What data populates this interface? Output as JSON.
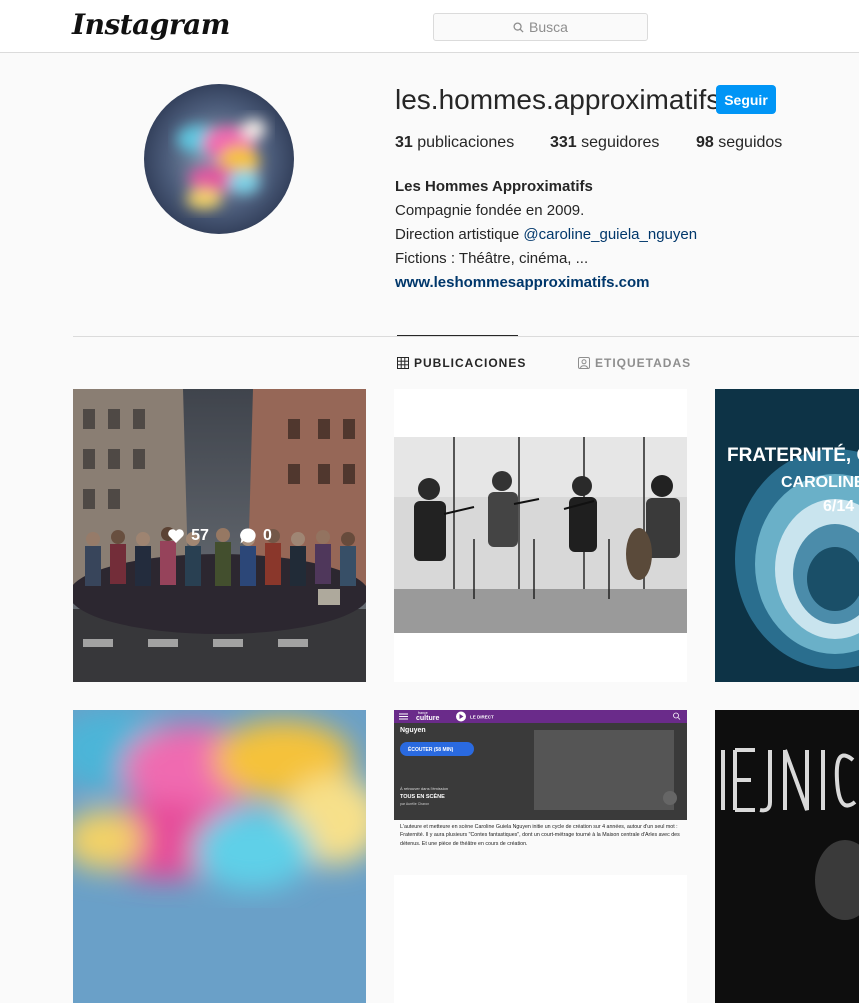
{
  "header": {
    "logo": "Instagram",
    "search_placeholder": "Busca"
  },
  "profile": {
    "username": "les.hommes.approximatifs",
    "follow_label": "Seguir",
    "stats": {
      "posts_count": "31",
      "posts_label": "publicaciones",
      "followers_count": "331",
      "followers_label": "seguidores",
      "following_count": "98",
      "following_label": "seguidos"
    },
    "bio": {
      "full_name": "Les Hommes Approximatifs",
      "line1": "Compagnie fondée en 2009.",
      "line2_prefix": "Direction artistique ",
      "line2_mention": "@caroline_guiela_nguyen",
      "line3": "Fictions : Théâtre, cinéma, ...",
      "website": "www.leshommesapproximatifs.com"
    }
  },
  "tabs": [
    {
      "label": "PUBLICACIONES",
      "icon": "grid-icon",
      "active": true
    },
    {
      "label": "ETIQUETADAS",
      "icon": "tagged-user-icon",
      "active": false
    }
  ],
  "posts": [
    {
      "likes": "57",
      "comments": "0"
    }
  ],
  "post_texts": {
    "fraternite_title": "FRATERNITÉ, CO",
    "fraternite_sub1": "CAROLINE G",
    "fraternite_sub2": "6/14",
    "radio_brand_small": "france",
    "radio_brand": "culture",
    "radio_live": "LE DIRECT",
    "radio_name": "Nguyen",
    "radio_listen": "ÉCOUTER (58 MIN)",
    "radio_retrouver": "À retrouver dans l'émission",
    "radio_show": "TOUS EN SCÈNE",
    "radio_host": "par Aurélie Charon",
    "radio_desc": "L'auteure et metteure en scène Caroline Guiela Nguyen initie un cycle de création sur 4 années, autour d'un seul mot : Fraternité. Il y aura plusieurs \"Contes fantastiques\", dont un court-métrage tourné à la Maison centrale d'Arles avec des détenus. Et une pièce de théâtre en cours de création."
  },
  "colors": {
    "accent": "#0095f6",
    "link": "#00376b",
    "border": "#dbdbdb",
    "background": "#fafafa"
  }
}
